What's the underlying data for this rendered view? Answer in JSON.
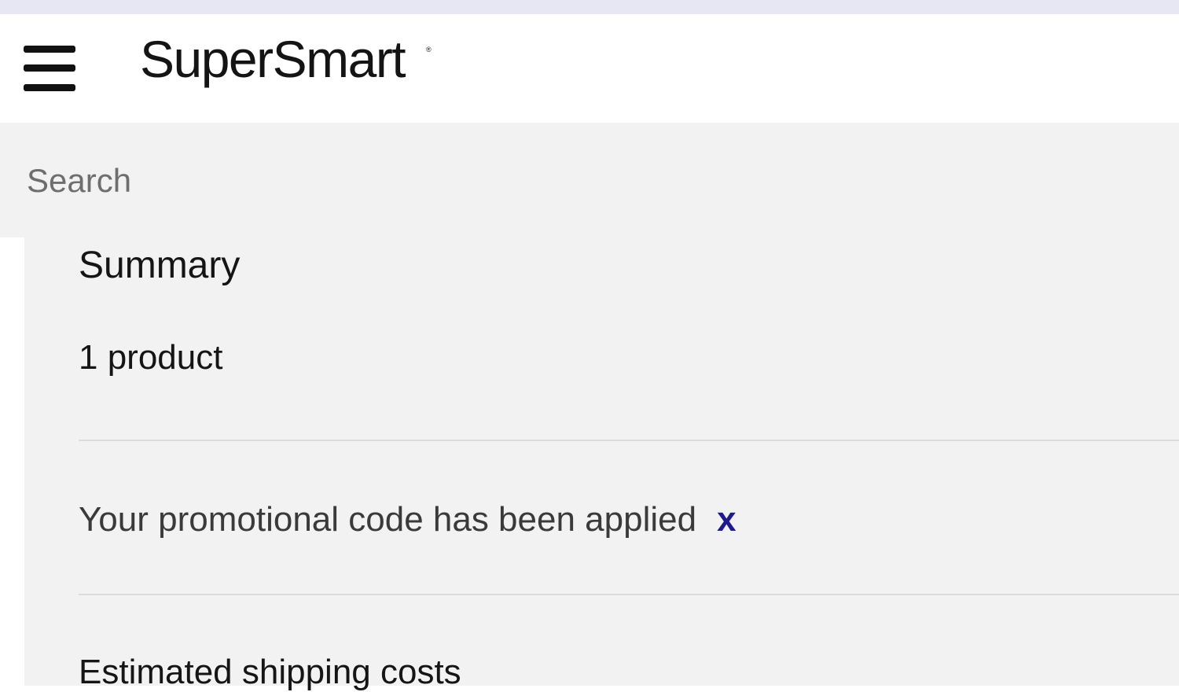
{
  "header": {
    "logo_text": "SuperSmart",
    "logo_mark": "®",
    "menu_icon": "hamburger-menu-icon"
  },
  "search": {
    "placeholder": "Search"
  },
  "summary": {
    "title": "Summary",
    "product_count": "1 product",
    "promo_message": "Your promotional code has been applied",
    "promo_remove_label": "x",
    "shipping_label": "Estimated shipping costs"
  },
  "colors": {
    "top_strip": "#e7e7f3",
    "panel_background": "#f2f2f2",
    "promo_remove": "#1f1a8f"
  }
}
